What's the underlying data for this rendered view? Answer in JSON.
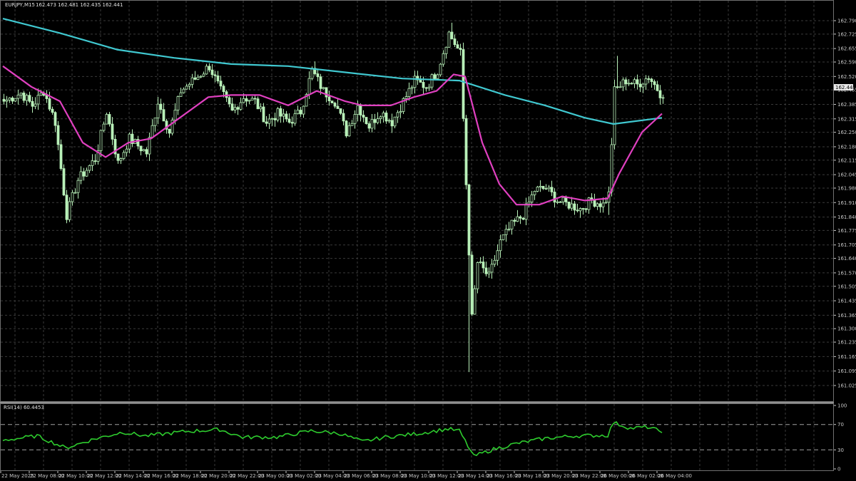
{
  "header": {
    "symbol_label": "EURJPY,M15",
    "ohlc_label": "162.473 162.481 162.435 162.441"
  },
  "rsi_panel": {
    "label": "RSI(14) 60.4453",
    "levels": [
      100,
      70,
      30,
      0
    ],
    "colors": {
      "line": "#2ecc2e",
      "level_line": "#a0a0a0"
    }
  },
  "current_price_label": "162.441",
  "colors": {
    "background": "#000000",
    "grid": "#3a3a3a",
    "candle": "#b8f0b8",
    "ma_fast": "#e040c0",
    "ma_slow": "#40c8d0",
    "axis_text": "#c8c8c8"
  },
  "chart_data": {
    "type": "candlestick",
    "symbol": "EURJPY",
    "timeframe": "M15",
    "y_tick_labels": [
      "162.790",
      "162.725",
      "162.655",
      "162.590",
      "162.520",
      "162.455",
      "162.385",
      "162.315",
      "162.250",
      "162.180",
      "162.115",
      "162.045",
      "161.980",
      "161.910",
      "161.840",
      "161.775",
      "161.705",
      "161.640",
      "161.570",
      "161.505",
      "161.435",
      "161.365",
      "161.300",
      "161.235",
      "161.165",
      "161.095",
      "161.025"
    ],
    "ylim": [
      161.025,
      162.79
    ],
    "x_tick_labels": [
      "22 May 2025",
      "22 May 08:00",
      "22 May 10:00",
      "22 May 12:00",
      "22 May 14:00",
      "22 May 16:00",
      "22 May 18:00",
      "22 May 20:00",
      "22 May 22:00",
      "23 May 00:00",
      "23 May 02:00",
      "23 May 04:00",
      "23 May 06:00",
      "23 May 08:00",
      "23 May 10:00",
      "23 May 12:00",
      "23 May 14:00",
      "23 May 16:00",
      "23 May 18:00",
      "23 May 20:00",
      "23 May 22:00",
      "26 May 00:00",
      "26 May 02:00",
      "26 May 04:00"
    ],
    "anchors": [
      {
        "i": 0,
        "p": 162.4
      },
      {
        "i": 6,
        "p": 162.44
      },
      {
        "i": 10,
        "p": 162.38
      },
      {
        "i": 14,
        "p": 162.45
      },
      {
        "i": 18,
        "p": 162.3
      },
      {
        "i": 22,
        "p": 161.85
      },
      {
        "i": 26,
        "p": 162.02
      },
      {
        "i": 32,
        "p": 162.12
      },
      {
        "i": 36,
        "p": 162.35
      },
      {
        "i": 40,
        "p": 162.1
      },
      {
        "i": 44,
        "p": 162.22
      },
      {
        "i": 50,
        "p": 162.15
      },
      {
        "i": 54,
        "p": 162.4
      },
      {
        "i": 58,
        "p": 162.25
      },
      {
        "i": 62,
        "p": 162.45
      },
      {
        "i": 68,
        "p": 162.52
      },
      {
        "i": 72,
        "p": 162.57
      },
      {
        "i": 76,
        "p": 162.45
      },
      {
        "i": 80,
        "p": 162.35
      },
      {
        "i": 84,
        "p": 162.42
      },
      {
        "i": 88,
        "p": 162.4
      },
      {
        "i": 92,
        "p": 162.3
      },
      {
        "i": 96,
        "p": 162.34
      },
      {
        "i": 100,
        "p": 162.3
      },
      {
        "i": 104,
        "p": 162.35
      },
      {
        "i": 108,
        "p": 162.55
      },
      {
        "i": 112,
        "p": 162.45
      },
      {
        "i": 116,
        "p": 162.4
      },
      {
        "i": 120,
        "p": 162.25
      },
      {
        "i": 124,
        "p": 162.38
      },
      {
        "i": 128,
        "p": 162.28
      },
      {
        "i": 132,
        "p": 162.35
      },
      {
        "i": 136,
        "p": 162.3
      },
      {
        "i": 140,
        "p": 162.4
      },
      {
        "i": 144,
        "p": 162.5
      },
      {
        "i": 148,
        "p": 162.47
      },
      {
        "i": 152,
        "p": 162.55
      },
      {
        "i": 156,
        "p": 162.73
      },
      {
        "i": 160,
        "p": 162.63
      },
      {
        "i": 162,
        "p": 162.0
      },
      {
        "i": 164,
        "p": 161.35
      },
      {
        "i": 166,
        "p": 161.62
      },
      {
        "i": 170,
        "p": 161.55
      },
      {
        "i": 174,
        "p": 161.72
      },
      {
        "i": 178,
        "p": 161.8
      },
      {
        "i": 182,
        "p": 161.85
      },
      {
        "i": 186,
        "p": 161.97
      },
      {
        "i": 190,
        "p": 161.98
      },
      {
        "i": 194,
        "p": 161.92
      },
      {
        "i": 198,
        "p": 161.9
      },
      {
        "i": 202,
        "p": 161.88
      },
      {
        "i": 206,
        "p": 161.92
      },
      {
        "i": 210,
        "p": 161.9
      },
      {
        "i": 212,
        "p": 161.95
      },
      {
        "i": 214,
        "p": 162.45
      },
      {
        "i": 218,
        "p": 162.5
      },
      {
        "i": 222,
        "p": 162.48
      },
      {
        "i": 226,
        "p": 162.52
      },
      {
        "i": 230,
        "p": 162.44
      }
    ],
    "spikes": [
      {
        "i": 22,
        "low": 161.81
      },
      {
        "i": 163,
        "low": 161.09
      },
      {
        "i": 157,
        "high": 162.78
      },
      {
        "i": 215,
        "high": 162.62
      },
      {
        "i": 212,
        "low": 161.85
      }
    ],
    "ma_fast": [
      {
        "i": 0,
        "p": 162.57
      },
      {
        "i": 10,
        "p": 162.47
      },
      {
        "i": 20,
        "p": 162.4
      },
      {
        "i": 28,
        "p": 162.2
      },
      {
        "i": 36,
        "p": 162.13
      },
      {
        "i": 44,
        "p": 162.2
      },
      {
        "i": 52,
        "p": 162.22
      },
      {
        "i": 62,
        "p": 162.32
      },
      {
        "i": 72,
        "p": 162.42
      },
      {
        "i": 80,
        "p": 162.43
      },
      {
        "i": 90,
        "p": 162.43
      },
      {
        "i": 100,
        "p": 162.38
      },
      {
        "i": 110,
        "p": 162.45
      },
      {
        "i": 120,
        "p": 162.4
      },
      {
        "i": 126,
        "p": 162.38
      },
      {
        "i": 136,
        "p": 162.38
      },
      {
        "i": 144,
        "p": 162.42
      },
      {
        "i": 152,
        "p": 162.45
      },
      {
        "i": 158,
        "p": 162.53
      },
      {
        "i": 162,
        "p": 162.52
      },
      {
        "i": 168,
        "p": 162.2
      },
      {
        "i": 174,
        "p": 162.0
      },
      {
        "i": 180,
        "p": 161.9
      },
      {
        "i": 188,
        "p": 161.9
      },
      {
        "i": 196,
        "p": 161.94
      },
      {
        "i": 204,
        "p": 161.92
      },
      {
        "i": 212,
        "p": 161.93
      },
      {
        "i": 216,
        "p": 162.05
      },
      {
        "i": 224,
        "p": 162.25
      },
      {
        "i": 231,
        "p": 162.34
      }
    ],
    "ma_slow": [
      {
        "i": 0,
        "p": 162.8
      },
      {
        "i": 20,
        "p": 162.73
      },
      {
        "i": 40,
        "p": 162.65
      },
      {
        "i": 60,
        "p": 162.61
      },
      {
        "i": 80,
        "p": 162.58
      },
      {
        "i": 100,
        "p": 162.57
      },
      {
        "i": 120,
        "p": 162.54
      },
      {
        "i": 140,
        "p": 162.51
      },
      {
        "i": 160,
        "p": 162.5
      },
      {
        "i": 176,
        "p": 162.43
      },
      {
        "i": 190,
        "p": 162.38
      },
      {
        "i": 204,
        "p": 162.32
      },
      {
        "i": 214,
        "p": 162.29
      },
      {
        "i": 231,
        "p": 162.32
      }
    ],
    "rsi_anchors": [
      {
        "i": 0,
        "v": 45
      },
      {
        "i": 12,
        "v": 52
      },
      {
        "i": 22,
        "v": 33
      },
      {
        "i": 32,
        "v": 47
      },
      {
        "i": 42,
        "v": 58
      },
      {
        "i": 50,
        "v": 52
      },
      {
        "i": 64,
        "v": 59
      },
      {
        "i": 76,
        "v": 62
      },
      {
        "i": 84,
        "v": 50
      },
      {
        "i": 96,
        "v": 50
      },
      {
        "i": 108,
        "v": 60
      },
      {
        "i": 118,
        "v": 56
      },
      {
        "i": 126,
        "v": 43
      },
      {
        "i": 134,
        "v": 50
      },
      {
        "i": 146,
        "v": 56
      },
      {
        "i": 156,
        "v": 63
      },
      {
        "i": 160,
        "v": 60
      },
      {
        "i": 165,
        "v": 20
      },
      {
        "i": 172,
        "v": 31
      },
      {
        "i": 180,
        "v": 40
      },
      {
        "i": 190,
        "v": 48
      },
      {
        "i": 200,
        "v": 52
      },
      {
        "i": 212,
        "v": 53
      },
      {
        "i": 214,
        "v": 73
      },
      {
        "i": 220,
        "v": 64
      },
      {
        "i": 226,
        "v": 66
      },
      {
        "i": 230,
        "v": 60
      }
    ],
    "rsi_ylim": [
      0,
      100
    ],
    "grid": true
  }
}
